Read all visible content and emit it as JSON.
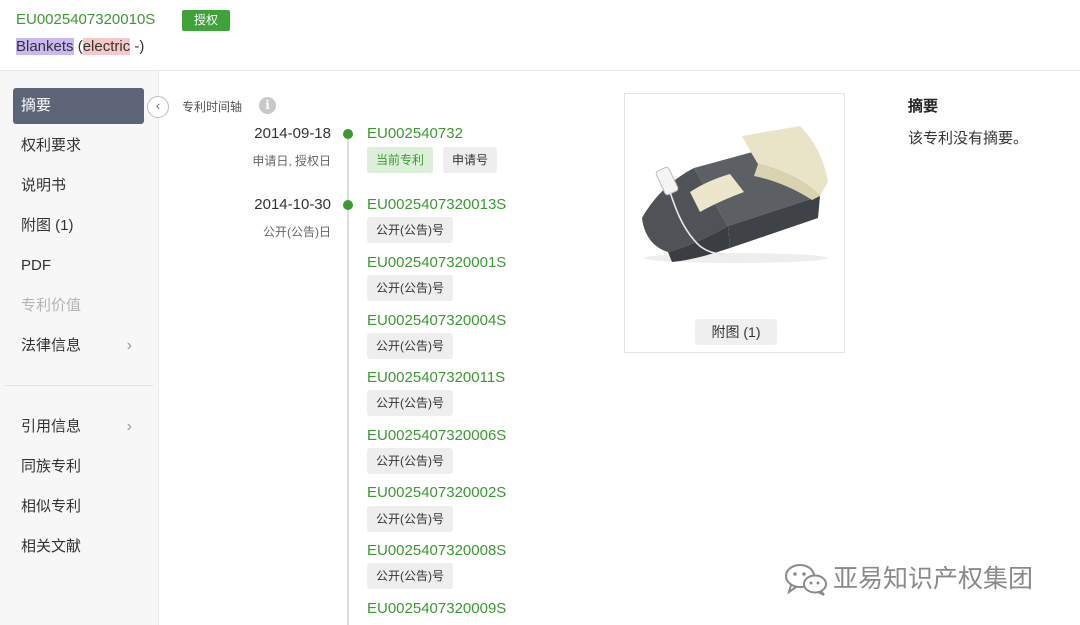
{
  "header": {
    "publication_number": "EU0025407320010S",
    "status_badge": "授权",
    "title_word1": "Blankets",
    "title_open": " (",
    "title_word2": "electric",
    "title_close": " -)"
  },
  "sidebar": {
    "collapse_icon": "chevron-left-icon",
    "items": [
      {
        "label": "摘要",
        "state": "active"
      },
      {
        "label": "权利要求"
      },
      {
        "label": "说明书"
      },
      {
        "label": "附图 (1)"
      },
      {
        "label": "PDF"
      },
      {
        "label": "专利价值",
        "state": "disabled"
      },
      {
        "label": "法律信息",
        "chevron": "›"
      },
      {
        "label": "引用信息",
        "chevron": "›"
      },
      {
        "label": "同族专利"
      },
      {
        "label": "相似专利"
      },
      {
        "label": "相关文献"
      }
    ]
  },
  "timeline": {
    "title": "专利时间轴",
    "info_icon": "i",
    "groups": [
      {
        "date": "2014-09-18",
        "date_label": "申请日, 授权日",
        "entries": [
          {
            "number": "EU002540732",
            "tags": [
              "当前专利",
              "申请号"
            ]
          }
        ]
      },
      {
        "date": "2014-10-30",
        "date_label": "公开(公告)日",
        "entries": [
          {
            "number": "EU0025407320013S",
            "tags": [
              "公开(公告)号"
            ]
          },
          {
            "number": "EU0025407320001S",
            "tags": [
              "公开(公告)号"
            ]
          },
          {
            "number": "EU0025407320004S",
            "tags": [
              "公开(公告)号"
            ]
          },
          {
            "number": "EU0025407320011S",
            "tags": [
              "公开(公告)号"
            ]
          },
          {
            "number": "EU0025407320006S",
            "tags": [
              "公开(公告)号"
            ]
          },
          {
            "number": "EU0025407320002S",
            "tags": [
              "公开(公告)号"
            ]
          },
          {
            "number": "EU0025407320008S",
            "tags": [
              "公开(公告)号"
            ]
          },
          {
            "number": "EU0025407320009S",
            "tags": []
          }
        ]
      }
    ]
  },
  "figure": {
    "button_label": "附图 (1)",
    "image": "electric-blanket-photo"
  },
  "abstract": {
    "title": "摘要",
    "text": "该专利没有摘要。"
  },
  "watermark": {
    "text": "亚易知识产权集团",
    "icon": "wechat-icon"
  },
  "colors": {
    "accent_green": "#3a9a2f",
    "active_nav": "#5d6478",
    "highlight_purple": "#c9b8f2",
    "highlight_red": "#f6c9c6"
  }
}
